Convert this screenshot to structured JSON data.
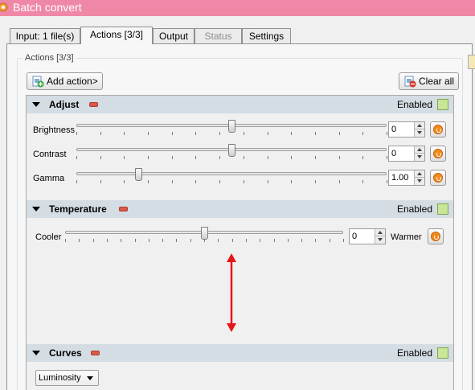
{
  "window": {
    "title": "Batch convert"
  },
  "tabs": [
    {
      "label": "Input: 1 file(s)",
      "active": false,
      "disabled": false
    },
    {
      "label": "Actions [3/3]",
      "active": true,
      "disabled": false
    },
    {
      "label": "Output",
      "active": false,
      "disabled": false
    },
    {
      "label": "Status",
      "active": false,
      "disabled": true
    },
    {
      "label": "Settings",
      "active": false,
      "disabled": false
    }
  ],
  "actions_group": {
    "title": "Actions [3/3]",
    "add_action_label": "Add action>",
    "clear_all_label": "Clear all"
  },
  "sections": {
    "adjust": {
      "title": "Adjust",
      "enabled_label": "Enabled",
      "enabled": true,
      "params": {
        "brightness": {
          "label": "Brightness",
          "value": "0",
          "slider_fraction": 0.5
        },
        "contrast": {
          "label": "Contrast",
          "value": "0",
          "slider_fraction": 0.5
        },
        "gamma": {
          "label": "Gamma",
          "value": "1.00",
          "slider_fraction": 0.2
        }
      }
    },
    "temperature": {
      "title": "Temperature",
      "enabled_label": "Enabled",
      "enabled": true,
      "cooler_label": "Cooler",
      "warmer_label": "Warmer",
      "value": "0",
      "slider_fraction": 0.5
    },
    "curves": {
      "title": "Curves",
      "enabled_label": "Enabled",
      "enabled": true,
      "channel": "Luminosity"
    }
  },
  "colors": {
    "titlebar": "#ef88a6",
    "section_header": "#d4dde4",
    "remove_icon": "#d95a4a",
    "enabled_check": "#c9e59a",
    "reset_icon": "#f28a1c",
    "annotation_arrow": "#e8151b"
  },
  "icons": {
    "app": "app-logo-icon",
    "add_action": "add-action-icon",
    "clear_all": "clear-all-icon",
    "remove": "remove-minus-icon",
    "enabled": "checkbox-checked-icon",
    "reset": "reset-icon",
    "expand": "triangle-down-icon",
    "annotation": "double-arrow-icon"
  }
}
